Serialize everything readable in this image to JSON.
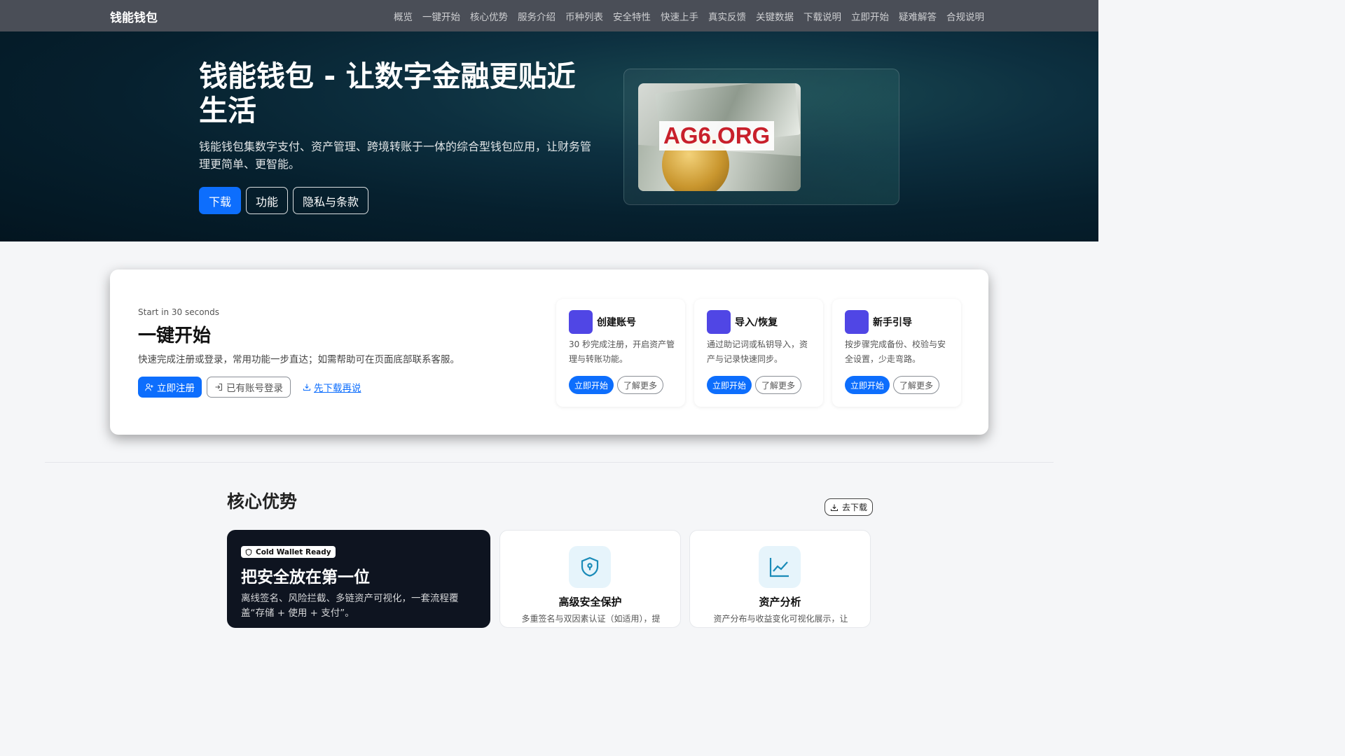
{
  "nav": {
    "brand": "钱能钱包",
    "links": [
      "概览",
      "一键开始",
      "核心优势",
      "服务介绍",
      "币种列表",
      "安全特性",
      "快速上手",
      "真实反馈",
      "关键数据",
      "下载说明",
      "立即开始",
      "疑难解答",
      "合规说明"
    ]
  },
  "hero": {
    "title": "钱能钱包 - 让数字金融更贴近生活",
    "subtitle": "钱能钱包集数字支付、资产管理、跨境转账于一体的综合型钱包应用，让财务管理更简单、更智能。",
    "buttons": [
      "下载",
      "功能",
      "隐私与条款"
    ],
    "image_stamp": "AG6.ORG"
  },
  "quickstart": {
    "eyebrow": "Start in 30 seconds",
    "title": "一键开始",
    "desc": "快速完成注册或登录，常用功能一步直达；如需帮助可在页面底部联系客服。",
    "register": "立即注册",
    "login": "已有账号登录",
    "download_first": "先下载再说",
    "steps": [
      {
        "title": "创建账号",
        "desc": "30 秒完成注册，开启资产管理与转账功能。",
        "primary": "立即开始",
        "secondary": "了解更多"
      },
      {
        "title": "导入/恢复",
        "desc": "通过助记词或私钥导入，资产与记录快速同步。",
        "primary": "立即开始",
        "secondary": "了解更多"
      },
      {
        "title": "新手引导",
        "desc": "按步骤完成备份、校验与安全设置，少走弯路。",
        "primary": "立即开始",
        "secondary": "了解更多"
      }
    ]
  },
  "core": {
    "title": "核心优势",
    "download": "去下载",
    "highlight": {
      "badge": "Cold Wallet Ready",
      "title": "把安全放在第一位",
      "desc": "离线签名、风险拦截、多链资产可视化，一套流程覆盖“存储 + 使用 + 支付”。"
    },
    "features": [
      {
        "title": "高级安全保护",
        "desc": "多重签名与双因素认证（如适用），提"
      },
      {
        "title": "资产分析",
        "desc": "资产分布与收益变化可视化展示，让"
      }
    ]
  },
  "colors": {
    "primary": "#0d6efd",
    "accent": "#5046e5",
    "nav_bg": "#4a4e57"
  }
}
